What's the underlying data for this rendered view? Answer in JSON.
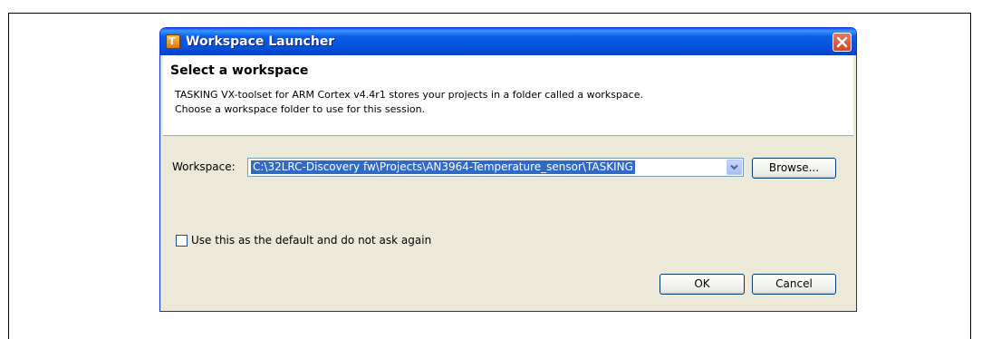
{
  "window": {
    "title": "Workspace Launcher"
  },
  "header": {
    "title": "Select a workspace",
    "description_line1": "TASKING VX-toolset for ARM Cortex v4.4r1 stores your projects in a folder called a workspace.",
    "description_line2": "Choose a workspace folder to use for this session."
  },
  "workspace": {
    "label": "Workspace:",
    "value": "C:\\32LRC-Discovery fw\\Projects\\AN3964-Temperature_sensor\\TASKING",
    "browse_label": "Browse..."
  },
  "default_checkbox": {
    "label": "Use this as the default and do not ask again",
    "checked": false
  },
  "buttons": {
    "ok_label": "OK",
    "cancel_label": "Cancel"
  },
  "icons": {
    "app": "tasking-app-icon",
    "close": "close-icon",
    "dropdown": "chevron-down-icon"
  },
  "colors": {
    "titlebar": "#0a5fe9",
    "dialog_background": "#ece9d8",
    "selection": "#316ac5",
    "close_button": "#d2462a"
  }
}
